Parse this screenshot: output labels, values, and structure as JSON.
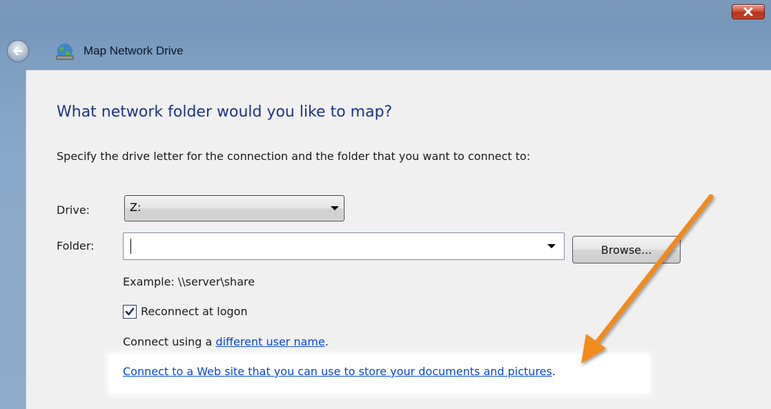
{
  "window": {
    "title": "Map Network Drive",
    "close_icon": "close-icon"
  },
  "page": {
    "heading": "What network folder would you like to map?",
    "instructions": "Specify the drive letter for the connection and the folder that you want to connect to:"
  },
  "form": {
    "drive_label": "Drive:",
    "drive_value": "Z:",
    "folder_label": "Folder:",
    "folder_value": "",
    "browse_label": "Browse...",
    "example_text": "Example: \\\\server\\share",
    "reconnect_label": "Reconnect at logon",
    "reconnect_checked": true,
    "connect_prefix": "Connect using a ",
    "different_user_link": "different user name",
    "connect_suffix": ".",
    "web_site_link": "Connect to a Web site that you can use to store your documents and pictures",
    "web_site_suffix": "."
  },
  "annotation": {
    "arrow_color": "#f28a1e"
  }
}
